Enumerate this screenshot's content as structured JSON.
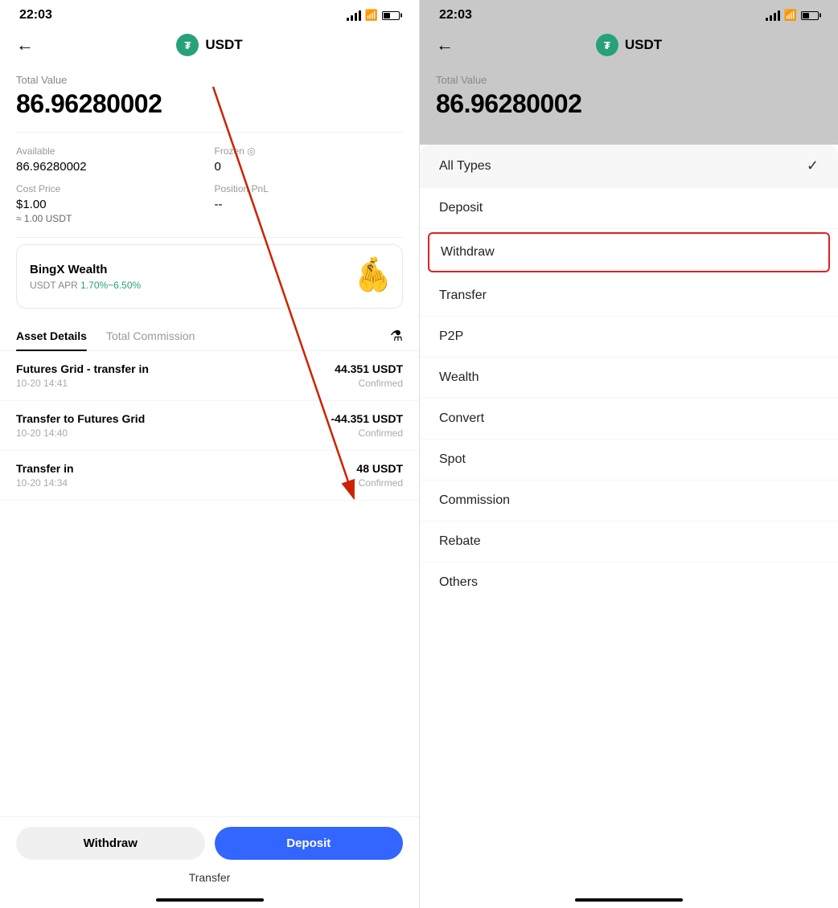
{
  "left": {
    "status": {
      "time": "22:03"
    },
    "nav": {
      "back_label": "←",
      "title": "USDT",
      "logo_text": "₮"
    },
    "total_value": {
      "label": "Total Value",
      "amount": "86.96280002"
    },
    "stats": [
      {
        "label": "Available",
        "value": "86.96280002",
        "sub": ""
      },
      {
        "label": "Frozen ◎",
        "value": "0",
        "sub": ""
      },
      {
        "label": "Cost Price",
        "value": "$1.00",
        "sub": "≈ 1.00 USDT"
      },
      {
        "label": "Position PnL",
        "value": "--",
        "sub": ""
      }
    ],
    "wealth_card": {
      "title": "BingX Wealth",
      "apr_label": "USDT APR ",
      "apr_value": "1.70%~6.50%"
    },
    "tabs": [
      {
        "label": "Asset Details",
        "active": true
      },
      {
        "label": "Total Commission",
        "active": false
      }
    ],
    "transactions": [
      {
        "title": "Futures Grid - transfer in",
        "date": "10-20 14:41",
        "amount": "44.351 USDT",
        "status": "Confirmed",
        "negative": false
      },
      {
        "title": "Transfer to Futures Grid",
        "date": "10-20 14:40",
        "amount": "-44.351 USDT",
        "status": "Confirmed",
        "negative": true
      },
      {
        "title": "Transfer in",
        "date": "10-20 14:34",
        "amount": "48 USDT",
        "status": "Confirmed",
        "negative": false
      }
    ],
    "actions": {
      "withdraw_label": "Withdraw",
      "deposit_label": "Deposit",
      "transfer_label": "Transfer"
    }
  },
  "right": {
    "status": {
      "time": "22:03"
    },
    "nav": {
      "back_label": "←",
      "title": "USDT",
      "logo_text": "₮"
    },
    "total_value": {
      "label": "Total Value",
      "amount": "86.96280002"
    },
    "dropdown": {
      "items": [
        {
          "label": "All Types",
          "selected": true,
          "highlighted": false
        },
        {
          "label": "Deposit",
          "selected": false,
          "highlighted": false
        },
        {
          "label": "Withdraw",
          "selected": false,
          "highlighted": true
        },
        {
          "label": "Transfer",
          "selected": false,
          "highlighted": false
        },
        {
          "label": "P2P",
          "selected": false,
          "highlighted": false
        },
        {
          "label": "Wealth",
          "selected": false,
          "highlighted": false
        },
        {
          "label": "Convert",
          "selected": false,
          "highlighted": false
        },
        {
          "label": "Spot",
          "selected": false,
          "highlighted": false
        },
        {
          "label": "Commission",
          "selected": false,
          "highlighted": false
        },
        {
          "label": "Rebate",
          "selected": false,
          "highlighted": false
        },
        {
          "label": "Others",
          "selected": false,
          "highlighted": false
        }
      ]
    }
  }
}
